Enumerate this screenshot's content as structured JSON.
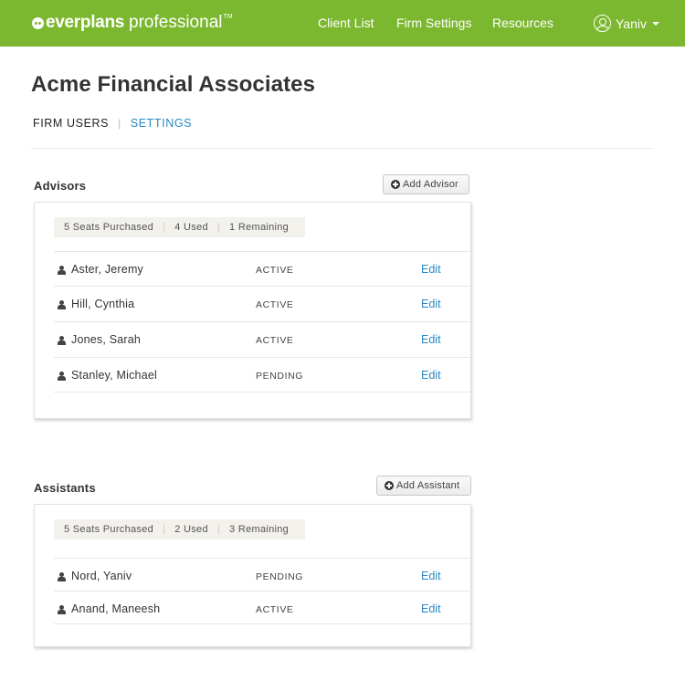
{
  "header": {
    "logo_bold": "everplans",
    "logo_light": "professional",
    "logo_tm": "TM",
    "nav": [
      "Client List",
      "Firm Settings",
      "Resources"
    ],
    "user_name": "Yaniv",
    "colors": {
      "bar": "#7cb82f",
      "link": "#2a87c5"
    }
  },
  "page": {
    "title": "Acme Financial Associates",
    "subnav_active": "FIRM USERS",
    "subnav_link": "SETTINGS"
  },
  "advisors": {
    "title": "Advisors",
    "add_label": "Add Advisor",
    "seats": {
      "purchased": "5 Seats Purchased",
      "used": "4 Used",
      "remaining": "1 Remaining"
    },
    "rows": [
      {
        "name": "Aster, Jeremy",
        "status": "ACTIVE",
        "action": "Edit"
      },
      {
        "name": "Hill, Cynthia",
        "status": "ACTIVE",
        "action": "Edit"
      },
      {
        "name": "Jones, Sarah",
        "status": "ACTIVE",
        "action": "Edit"
      },
      {
        "name": "Stanley, Michael",
        "status": "PENDING",
        "action": "Edit"
      }
    ]
  },
  "assistants": {
    "title": "Assistants",
    "add_label": "Add Assistant",
    "seats": {
      "purchased": "5 Seats Purchased",
      "used": "2 Used",
      "remaining": "3 Remaining"
    },
    "rows": [
      {
        "name": "Nord, Yaniv",
        "status": "PENDING",
        "action": "Edit"
      },
      {
        "name": "Anand, Maneesh",
        "status": "ACTIVE",
        "action": "Edit"
      }
    ]
  }
}
